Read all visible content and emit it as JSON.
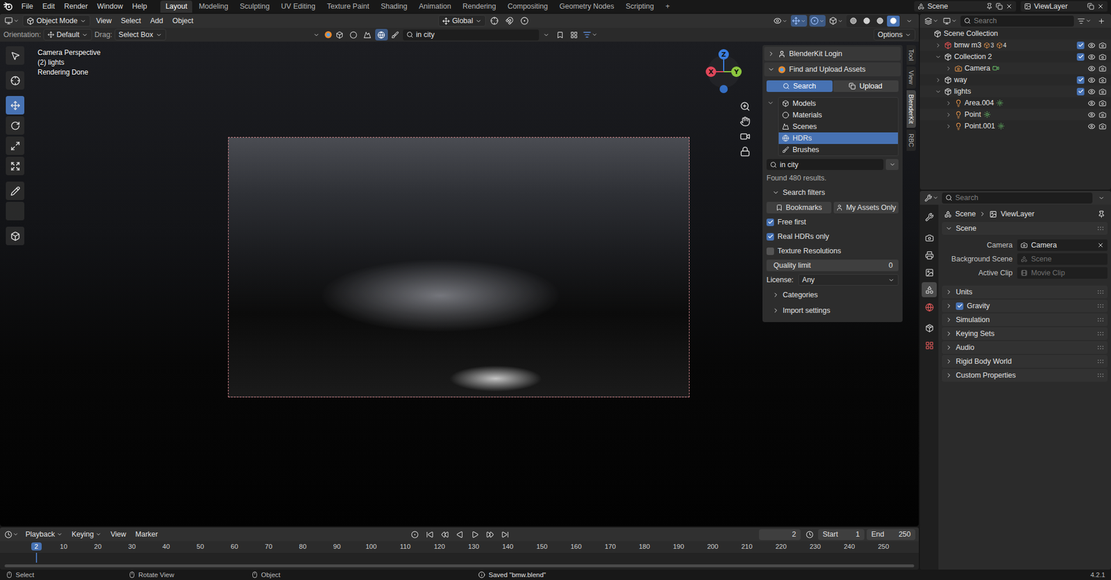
{
  "topbar": {
    "menus": [
      "File",
      "Edit",
      "Render",
      "Window",
      "Help"
    ],
    "workspaces": [
      {
        "label": "Layout",
        "selected": true
      },
      {
        "label": "Modeling",
        "selected": false
      },
      {
        "label": "Sculpting",
        "selected": false
      },
      {
        "label": "UV Editing",
        "selected": false
      },
      {
        "label": "Texture Paint",
        "selected": false
      },
      {
        "label": "Shading",
        "selected": false
      },
      {
        "label": "Animation",
        "selected": false
      },
      {
        "label": "Rendering",
        "selected": false
      },
      {
        "label": "Compositing",
        "selected": false
      },
      {
        "label": "Geometry Nodes",
        "selected": false
      },
      {
        "label": "Scripting",
        "selected": false
      }
    ],
    "add_workspace": "+",
    "scene": "Scene",
    "view_layer": "ViewLayer"
  },
  "viewport_header": {
    "mode": "Object Mode",
    "menus": [
      "View",
      "Select",
      "Add",
      "Object"
    ],
    "transform_orientation": "Global",
    "toggles": [
      {
        "selected": false
      },
      {
        "selected": true
      },
      {
        "selected": true
      },
      {
        "selected": false
      }
    ],
    "shading": [
      {
        "selected": false
      },
      {
        "selected": false
      },
      {
        "selected": false
      },
      {
        "selected": true
      }
    ]
  },
  "tool_settings": {
    "orientation_label": "Orientation:",
    "orientation": "Default",
    "drag_label": "Drag:",
    "drag": "Select Box",
    "asset_search": "in city",
    "options": "Options"
  },
  "viewport": {
    "overlay_lines": [
      "Camera Perspective",
      "(2) lights",
      "Rendering Done"
    ],
    "tools": [
      {
        "selected": false
      },
      {
        "selected": false
      },
      {
        "selected": true
      },
      {
        "selected": false
      },
      {
        "selected": false
      },
      {
        "selected": false
      },
      {
        "selected": false
      },
      {
        "selected": false
      },
      {
        "selected": false
      }
    ],
    "axes": [
      {
        "label": "Z",
        "color": "#3b7ee0"
      },
      {
        "label": "X",
        "color": "#e0475a"
      },
      {
        "label": "Y",
        "color": "#8cc63f"
      }
    ]
  },
  "sidebar_tabs": [
    {
      "label": "Tool",
      "selected": false
    },
    {
      "label": "View",
      "selected": false
    },
    {
      "label": "BlenderKit",
      "selected": true
    },
    {
      "label": "RBC",
      "selected": false
    }
  ],
  "blenderkit": {
    "login": "BlenderKit Login",
    "login_expanded": false,
    "title": "Find and Upload Assets",
    "title_expanded": true,
    "modes": [
      {
        "label": "Search",
        "selected": true
      },
      {
        "label": "Upload",
        "selected": false
      }
    ],
    "asset_types": [
      {
        "label": "Models",
        "selected": false
      },
      {
        "label": "Materials",
        "selected": false
      },
      {
        "label": "Scenes",
        "selected": false
      },
      {
        "label": "HDRs",
        "selected": true
      },
      {
        "label": "Brushes",
        "selected": false
      }
    ],
    "query": "in city",
    "results": "Found 480 results.",
    "filters": {
      "label": "Search filters",
      "expanded": true
    },
    "buttons": [
      "Bookmarks",
      "My Assets Only"
    ],
    "checks": [
      {
        "label": "Free first",
        "checked": true
      },
      {
        "label": "Real HDRs only",
        "checked": true
      },
      {
        "label": "Texture Resolutions",
        "checked": false
      }
    ],
    "quality": {
      "label": "Quality limit",
      "value": "0",
      "level": 0
    },
    "license": {
      "label": "License:",
      "value": "Any"
    },
    "sections": [
      {
        "label": "Categories",
        "expanded": false
      },
      {
        "label": "Import settings",
        "expanded": false
      }
    ]
  },
  "timeline": {
    "menus": [
      {
        "label": "Playback",
        "dropdown": true
      },
      {
        "label": "Keying",
        "dropdown": true
      },
      {
        "label": "View",
        "dropdown": false
      },
      {
        "label": "Marker",
        "dropdown": false
      }
    ],
    "current_frame": "2",
    "start_label": "Start",
    "start": "1",
    "end_label": "End",
    "end": "250",
    "ticks": [
      "10",
      "20",
      "30",
      "40",
      "50",
      "60",
      "70",
      "80",
      "90",
      "100",
      "110",
      "120",
      "130",
      "140",
      "150",
      "160",
      "170",
      "180",
      "190",
      "200",
      "210",
      "220",
      "230",
      "240",
      "250"
    ],
    "playhead": "2"
  },
  "outliner": {
    "search": "Search",
    "rows": [
      {
        "label": "Scene Collection",
        "kind": "root",
        "depth": 0,
        "expanded": true,
        "color": "#d9d9d9",
        "badges": [],
        "checked": true,
        "visible": true
      },
      {
        "label": "bmw m3",
        "kind": "collection",
        "depth": 1,
        "expanded": false,
        "color": "#e25252",
        "badges": [
          "3",
          "4"
        ],
        "checked": true,
        "visible": true
      },
      {
        "label": "Collection 2",
        "kind": "collection",
        "depth": 1,
        "expanded": true,
        "color": "#d9d9d9",
        "badges": [],
        "checked": true,
        "visible": true
      },
      {
        "label": "Camera",
        "kind": "camera",
        "depth": 2,
        "expanded": false,
        "color": "#e8954a",
        "badges": [],
        "checked": false,
        "visible": true
      },
      {
        "label": "way",
        "kind": "collection",
        "depth": 1,
        "expanded": false,
        "color": "#d9d9d9",
        "badges": [],
        "checked": true,
        "visible": true
      },
      {
        "label": "lights",
        "kind": "collection",
        "depth": 1,
        "expanded": true,
        "color": "#d9d9d9",
        "badges": [],
        "checked": true,
        "visible": true
      },
      {
        "label": "Area.004",
        "kind": "light",
        "depth": 2,
        "expanded": false,
        "color": "#e8954a",
        "badges": [],
        "checked": false,
        "visible": true
      },
      {
        "label": "Point",
        "kind": "light",
        "depth": 2,
        "expanded": false,
        "color": "#e8954a",
        "badges": [],
        "checked": false,
        "visible": true
      },
      {
        "label": "Point.001",
        "kind": "light",
        "depth": 2,
        "expanded": false,
        "color": "#e8954a",
        "badges": [],
        "checked": false,
        "visible": true
      }
    ]
  },
  "properties": {
    "search": "Search",
    "breadcrumb": [
      "Scene",
      "ViewLayer"
    ],
    "tabs": [
      {
        "selected": false
      },
      {
        "selected": false
      },
      {
        "selected": false
      },
      {
        "selected": false
      },
      {
        "selected": true
      },
      {
        "selected": false
      },
      {
        "selected": false
      },
      {
        "selected": false
      }
    ],
    "panel": {
      "title": "Scene",
      "expanded": true,
      "fields": [
        {
          "label": "Camera",
          "value": "Camera",
          "empty": false
        },
        {
          "label": "Background Scene",
          "value": "Scene",
          "empty": true
        },
        {
          "label": "Active Clip",
          "value": "Movie Clip",
          "empty": true
        }
      ]
    },
    "sections": [
      {
        "label": "Units",
        "kind": "plain",
        "checked": false
      },
      {
        "label": "Gravity",
        "kind": "checkbox",
        "checked": true
      },
      {
        "label": "Simulation",
        "kind": "plain",
        "checked": false
      },
      {
        "label": "Keying Sets",
        "kind": "plain",
        "checked": false
      },
      {
        "label": "Audio",
        "kind": "plain",
        "checked": false
      },
      {
        "label": "Rigid Body World",
        "kind": "plain",
        "checked": false
      },
      {
        "label": "Custom Properties",
        "kind": "plain",
        "checked": false
      }
    ]
  },
  "status_bar": {
    "hints": [
      "Select",
      "Rotate View",
      "Object"
    ],
    "message": "Saved \"bmw.blend\"",
    "version": "4.2.1"
  }
}
